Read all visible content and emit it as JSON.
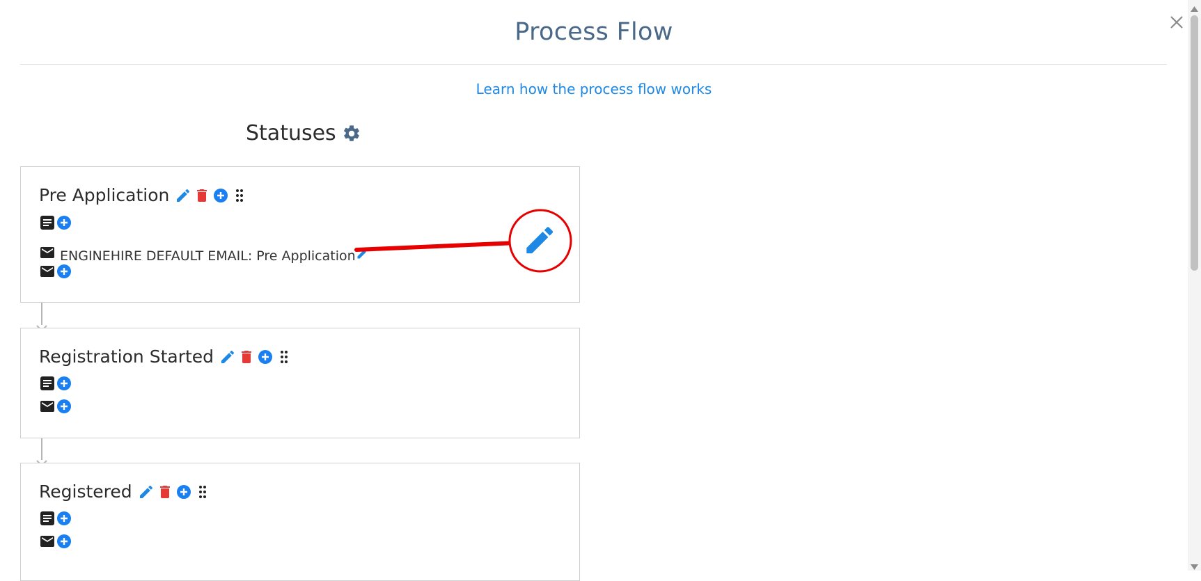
{
  "modal": {
    "title": "Process Flow",
    "learn_link": "Learn how the process flow works",
    "statuses_heading": "Statuses"
  },
  "statuses": [
    {
      "name": "Pre Application",
      "email_entries": [
        "ENGINEHIRE DEFAULT EMAIL: Pre Application"
      ]
    },
    {
      "name": "Registration Started",
      "email_entries": []
    },
    {
      "name": "Registered",
      "email_entries": []
    }
  ],
  "colors": {
    "title": "#4a6888",
    "link": "#1e88e5",
    "edit_icon": "#1e88e5",
    "delete_icon": "#e53935",
    "add_icon": "#1a7ff0",
    "annotation": "#e60000"
  }
}
